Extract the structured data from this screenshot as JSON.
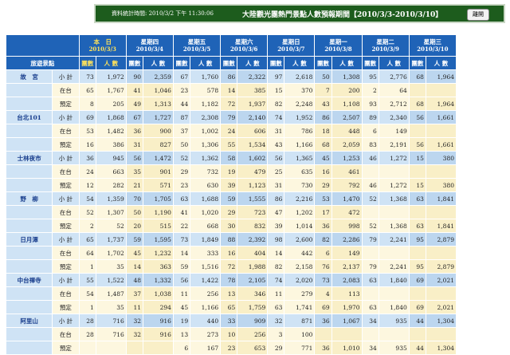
{
  "banner": {
    "stamp": "資料統計時間: 2010/3/2 下午 11:30:06",
    "title": "大陸觀光團熱門景點人數預報期間【2010/3/3-2010/3/10】",
    "close_label": "離開"
  },
  "header": {
    "spot_label": "旅遊景點",
    "count_label": "團數",
    "people_label": "人 數",
    "days": [
      {
        "name": "本　日",
        "date": "2010/3/3"
      },
      {
        "name": "星期四",
        "date": "2010/3/4"
      },
      {
        "name": "星期五",
        "date": "2010/3/5"
      },
      {
        "name": "星期六",
        "date": "2010/3/6"
      },
      {
        "name": "星期日",
        "date": "2010/3/7"
      },
      {
        "name": "星期一",
        "date": "2010/3/8"
      },
      {
        "name": "星期二",
        "date": "2010/3/9"
      },
      {
        "name": "星期三",
        "date": "2010/3/10"
      }
    ]
  },
  "spots": [
    {
      "name": "故　宮",
      "rows": [
        {
          "label": "小 計",
          "vals": [
            "73",
            "1,972",
            "90",
            "2,359",
            "67",
            "1,760",
            "86",
            "2,322",
            "97",
            "2,618",
            "50",
            "1,308",
            "95",
            "2,776",
            "68",
            "1,964"
          ]
        },
        {
          "label": "在台",
          "vals": [
            "65",
            "1,767",
            "41",
            "1,046",
            "23",
            "578",
            "14",
            "385",
            "15",
            "370",
            "7",
            "200",
            "2",
            "64",
            "",
            ""
          ]
        },
        {
          "label": "預定",
          "vals": [
            "8",
            "205",
            "49",
            "1,313",
            "44",
            "1,182",
            "72",
            "1,937",
            "82",
            "2,248",
            "43",
            "1,108",
            "93",
            "2,712",
            "68",
            "1,964"
          ]
        }
      ]
    },
    {
      "name": "台北101",
      "rows": [
        {
          "label": "小 計",
          "vals": [
            "69",
            "1,868",
            "67",
            "1,727",
            "87",
            "2,308",
            "79",
            "2,140",
            "74",
            "1,952",
            "86",
            "2,507",
            "89",
            "2,340",
            "56",
            "1,661"
          ]
        },
        {
          "label": "在台",
          "vals": [
            "53",
            "1,482",
            "36",
            "900",
            "37",
            "1,002",
            "24",
            "606",
            "31",
            "786",
            "18",
            "448",
            "6",
            "149",
            "",
            ""
          ]
        },
        {
          "label": "預定",
          "vals": [
            "16",
            "386",
            "31",
            "827",
            "50",
            "1,306",
            "55",
            "1,534",
            "43",
            "1,166",
            "68",
            "2,059",
            "83",
            "2,191",
            "56",
            "1,661"
          ]
        }
      ]
    },
    {
      "name": "士林夜市",
      "rows": [
        {
          "label": "小 計",
          "vals": [
            "36",
            "945",
            "56",
            "1,472",
            "52",
            "1,362",
            "58",
            "1,602",
            "56",
            "1,365",
            "45",
            "1,253",
            "46",
            "1,272",
            "15",
            "380"
          ]
        },
        {
          "label": "在台",
          "vals": [
            "24",
            "663",
            "35",
            "901",
            "29",
            "732",
            "19",
            "479",
            "25",
            "635",
            "16",
            "461",
            "",
            "",
            "",
            ""
          ]
        },
        {
          "label": "預定",
          "vals": [
            "12",
            "282",
            "21",
            "571",
            "23",
            "630",
            "39",
            "1,123",
            "31",
            "730",
            "29",
            "792",
            "46",
            "1,272",
            "15",
            "380"
          ]
        }
      ]
    },
    {
      "name": "野　柳",
      "rows": [
        {
          "label": "小 計",
          "vals": [
            "54",
            "1,359",
            "70",
            "1,705",
            "63",
            "1,688",
            "59",
            "1,555",
            "86",
            "2,216",
            "53",
            "1,470",
            "52",
            "1,368",
            "63",
            "1,841"
          ]
        },
        {
          "label": "在台",
          "vals": [
            "52",
            "1,307",
            "50",
            "1,190",
            "41",
            "1,020",
            "29",
            "723",
            "47",
            "1,202",
            "17",
            "472",
            "",
            "",
            "",
            ""
          ]
        },
        {
          "label": "預定",
          "vals": [
            "2",
            "52",
            "20",
            "515",
            "22",
            "668",
            "30",
            "832",
            "39",
            "1,014",
            "36",
            "998",
            "52",
            "1,368",
            "63",
            "1,841"
          ]
        }
      ]
    },
    {
      "name": "日月潭",
      "rows": [
        {
          "label": "小 計",
          "vals": [
            "65",
            "1,737",
            "59",
            "1,595",
            "73",
            "1,849",
            "88",
            "2,392",
            "98",
            "2,600",
            "82",
            "2,286",
            "79",
            "2,241",
            "95",
            "2,879"
          ]
        },
        {
          "label": "在台",
          "vals": [
            "64",
            "1,702",
            "45",
            "1,232",
            "14",
            "333",
            "16",
            "404",
            "14",
            "442",
            "6",
            "149",
            "",
            "",
            "",
            ""
          ]
        },
        {
          "label": "預定",
          "vals": [
            "1",
            "35",
            "14",
            "363",
            "59",
            "1,516",
            "72",
            "1,988",
            "82",
            "2,158",
            "76",
            "2,137",
            "79",
            "2,241",
            "95",
            "2,879"
          ]
        }
      ]
    },
    {
      "name": "中台禪寺",
      "rows": [
        {
          "label": "小 計",
          "vals": [
            "55",
            "1,522",
            "48",
            "1,332",
            "56",
            "1,422",
            "78",
            "2,105",
            "74",
            "2,020",
            "73",
            "2,083",
            "63",
            "1,840",
            "69",
            "2,021"
          ]
        },
        {
          "label": "在台",
          "vals": [
            "54",
            "1,487",
            "37",
            "1,038",
            "11",
            "256",
            "13",
            "346",
            "11",
            "279",
            "4",
            "113",
            "",
            "",
            "",
            ""
          ]
        },
        {
          "label": "預定",
          "vals": [
            "1",
            "35",
            "11",
            "294",
            "45",
            "1,166",
            "65",
            "1,759",
            "63",
            "1,741",
            "69",
            "1,970",
            "63",
            "1,840",
            "69",
            "2,021"
          ]
        }
      ]
    },
    {
      "name": "阿里山",
      "rows": [
        {
          "label": "小 計",
          "vals": [
            "28",
            "716",
            "32",
            "916",
            "19",
            "440",
            "33",
            "909",
            "32",
            "871",
            "36",
            "1,067",
            "34",
            "935",
            "44",
            "1,304"
          ]
        },
        {
          "label": "在台",
          "vals": [
            "28",
            "716",
            "32",
            "916",
            "13",
            "273",
            "10",
            "256",
            "3",
            "100",
            "",
            "",
            "",
            "",
            "",
            ""
          ]
        },
        {
          "label": "預定",
          "vals": [
            "",
            "",
            "",
            "",
            "6",
            "167",
            "23",
            "653",
            "29",
            "771",
            "36",
            "1,010",
            "34",
            "935",
            "44",
            "1,304"
          ]
        }
      ]
    }
  ]
}
